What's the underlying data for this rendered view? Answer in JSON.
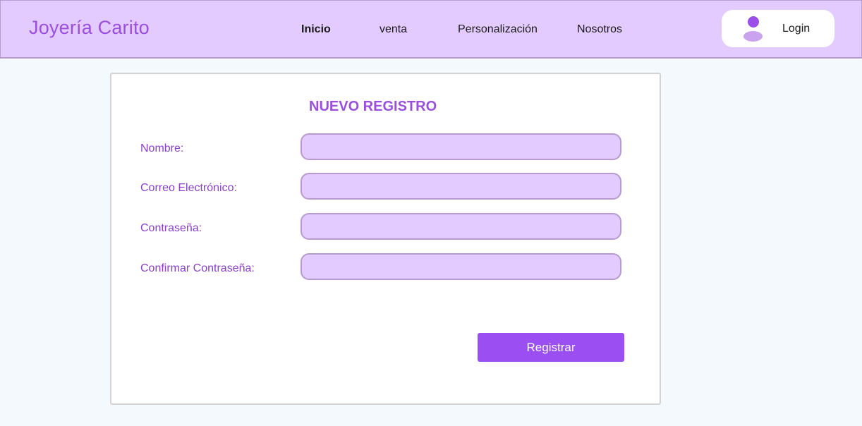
{
  "header": {
    "brand": "Joyería Carito",
    "nav": [
      {
        "label": "Inicio"
      },
      {
        "label": "venta"
      },
      {
        "label": "Personalización"
      },
      {
        "label": "Nosotros"
      }
    ],
    "login": {
      "icon": "user-icon",
      "label": "Login"
    }
  },
  "form": {
    "title": "NUEVO REGISTRO",
    "fields": [
      {
        "label": "Nombre:",
        "value": ""
      },
      {
        "label": "Correo Electrónico:",
        "value": ""
      },
      {
        "label": "Contraseña:",
        "value": ""
      },
      {
        "label": "Confirmar Contraseña:",
        "value": ""
      }
    ],
    "submit_label": "Registrar"
  },
  "colors": {
    "header_bg": "#e3cbff",
    "accent": "#9b4fe0",
    "button": "#9b4ff3",
    "input_bg": "#e3cbff",
    "page_bg": "#f4f9fd"
  }
}
